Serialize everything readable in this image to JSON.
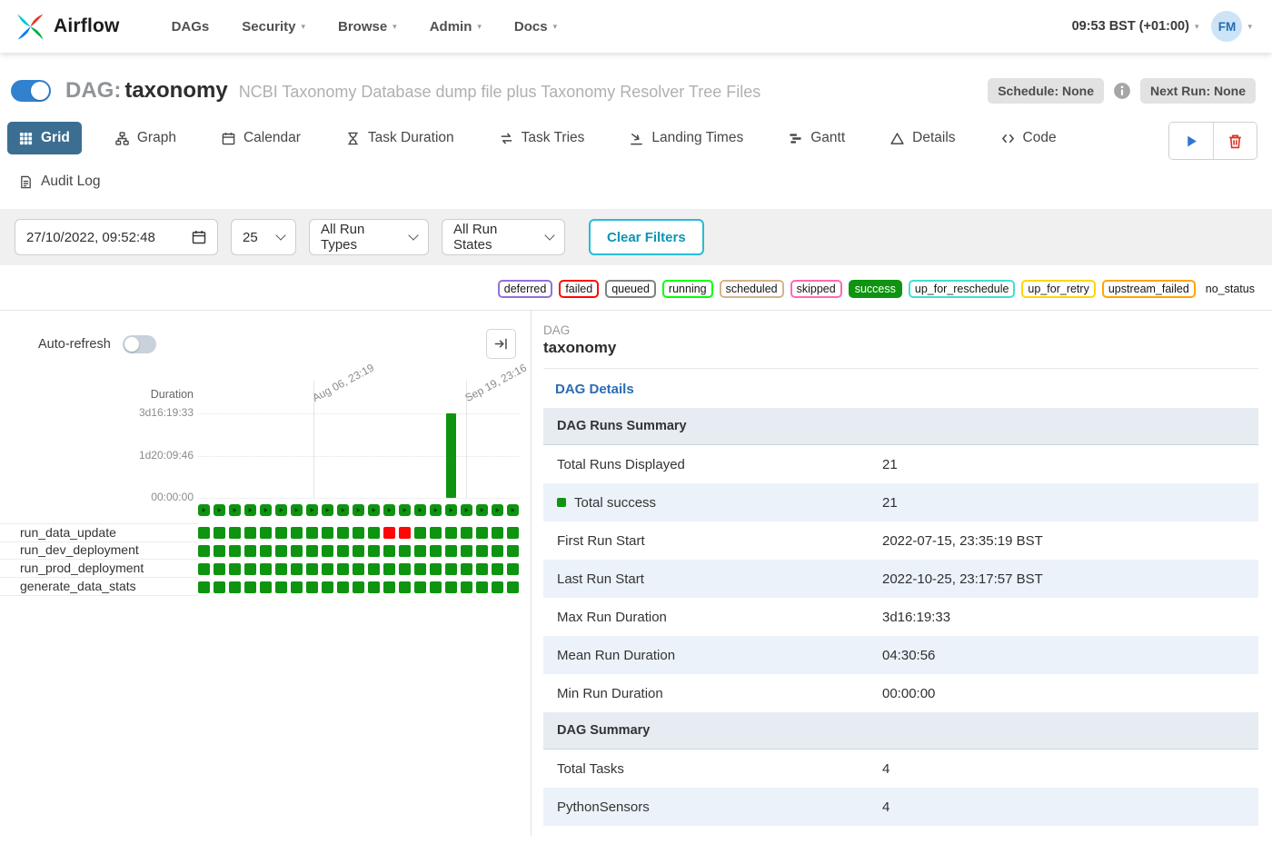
{
  "colors": {
    "active_tab": "#3c6e91",
    "link_blue": "#2b6cb0",
    "toggle_blue": "#3182ce",
    "clear_filters_teal": "#27bcd8",
    "success_green": "#0e9410",
    "failed_red": "#fe0707"
  },
  "navbar": {
    "brand": "Airflow",
    "items": [
      {
        "label": "DAGs",
        "caret": false
      },
      {
        "label": "Security",
        "caret": true
      },
      {
        "label": "Browse",
        "caret": true
      },
      {
        "label": "Admin",
        "caret": true
      },
      {
        "label": "Docs",
        "caret": true
      }
    ],
    "clock": "09:53 BST (+01:00)",
    "avatar_initials": "FM"
  },
  "dag_header": {
    "prefix": "DAG:",
    "name": "taxonomy",
    "description": "NCBI Taxonomy Database dump file plus Taxonomy Resolver Tree Files",
    "enabled": true,
    "schedule_badge": "Schedule: None",
    "next_run_badge": "Next Run: None"
  },
  "tabs": {
    "items": [
      {
        "label": "Grid",
        "icon": "grid-icon",
        "active": true,
        "row": 1
      },
      {
        "label": "Graph",
        "icon": "graph-icon",
        "active": false,
        "row": 1
      },
      {
        "label": "Calendar",
        "icon": "calendar-icon",
        "active": false,
        "row": 1
      },
      {
        "label": "Task Duration",
        "icon": "hourglass-icon",
        "active": false,
        "row": 1
      },
      {
        "label": "Task Tries",
        "icon": "retry-icon",
        "active": false,
        "row": 1
      },
      {
        "label": "Landing Times",
        "icon": "landing-icon",
        "active": false,
        "row": 1
      },
      {
        "label": "Gantt",
        "icon": "gantt-icon",
        "active": false,
        "row": 1
      },
      {
        "label": "Details",
        "icon": "details-icon",
        "active": false,
        "row": 1
      },
      {
        "label": "Code",
        "icon": "code-icon",
        "active": false,
        "row": 1
      },
      {
        "label": "Audit Log",
        "icon": "audit-icon",
        "active": false,
        "row": 2
      }
    ]
  },
  "filters": {
    "datetime": "27/10/2022, 09:52:48",
    "page_size": "25",
    "run_types": "All Run Types",
    "run_states": "All Run States",
    "clear_button": "Clear Filters"
  },
  "legend": {
    "items": [
      {
        "label": "deferred",
        "color": "#9370db",
        "filled": false,
        "plain": false
      },
      {
        "label": "failed",
        "color": "#fe0707",
        "filled": false,
        "plain": false
      },
      {
        "label": "queued",
        "color": "#808080",
        "filled": false,
        "plain": false
      },
      {
        "label": "running",
        "color": "#00ff00",
        "filled": false,
        "plain": false
      },
      {
        "label": "scheduled",
        "color": "#d2b48c",
        "filled": false,
        "plain": false
      },
      {
        "label": "skipped",
        "color": "#ff69b4",
        "filled": false,
        "plain": false
      },
      {
        "label": "success",
        "color": "#0e9410",
        "filled": true,
        "plain": false
      },
      {
        "label": "up_for_reschedule",
        "color": "#40e0d0",
        "filled": false,
        "plain": false
      },
      {
        "label": "up_for_retry",
        "color": "#ffd700",
        "filled": false,
        "plain": false
      },
      {
        "label": "upstream_failed",
        "color": "#ffa500",
        "filled": false,
        "plain": false
      },
      {
        "label": "no_status",
        "color": "#bbbbbb",
        "filled": false,
        "plain": true
      }
    ]
  },
  "grid_panel": {
    "auto_refresh_label": "Auto-refresh",
    "auto_refresh_on": false
  },
  "grid": {
    "run_statuses": [
      "success",
      "success",
      "success",
      "success",
      "success",
      "success",
      "success",
      "success",
      "success",
      "success",
      "success",
      "success",
      "success",
      "success",
      "success",
      "success",
      "success",
      "success",
      "success",
      "success",
      "success"
    ],
    "tasks": [
      {
        "name": "run_data_update",
        "statuses": [
          "success",
          "success",
          "success",
          "success",
          "success",
          "success",
          "success",
          "success",
          "success",
          "success",
          "success",
          "success",
          "failed",
          "failed",
          "success",
          "success",
          "success",
          "success",
          "success",
          "success",
          "success"
        ]
      },
      {
        "name": "run_dev_deployment",
        "statuses": [
          "success",
          "success",
          "success",
          "success",
          "success",
          "success",
          "success",
          "success",
          "success",
          "success",
          "success",
          "success",
          "success",
          "success",
          "success",
          "success",
          "success",
          "success",
          "success",
          "success",
          "success"
        ]
      },
      {
        "name": "run_prod_deployment",
        "statuses": [
          "success",
          "success",
          "success",
          "success",
          "success",
          "success",
          "success",
          "success",
          "success",
          "success",
          "success",
          "success",
          "success",
          "success",
          "success",
          "success",
          "success",
          "success",
          "success",
          "success",
          "success"
        ]
      },
      {
        "name": "generate_data_stats",
        "statuses": [
          "success",
          "success",
          "success",
          "success",
          "success",
          "success",
          "success",
          "success",
          "success",
          "success",
          "success",
          "success",
          "success",
          "success",
          "success",
          "success",
          "success",
          "success",
          "success",
          "success",
          "success"
        ]
      }
    ]
  },
  "chart_data": {
    "type": "bar",
    "title": "DAG run durations",
    "ylabel": "Duration",
    "y_ticks": [
      "3d16:19:33",
      "1d20:09:46",
      "00:00:00"
    ],
    "y_max_seconds": 317973,
    "x_gridlines": [
      {
        "label": "Aug 06, 23:19",
        "position_fraction": 0.36
      },
      {
        "label": "Sep 19, 23:16",
        "position_fraction": 0.836
      }
    ],
    "run_count": 21,
    "values_seconds": [
      0,
      0,
      0,
      0,
      0,
      0,
      0,
      0,
      0,
      0,
      0,
      0,
      0,
      0,
      0,
      0,
      317973,
      0,
      0,
      0,
      0
    ]
  },
  "details_panel": {
    "kicker": "DAG",
    "dag_name": "taxonomy",
    "details_link": "DAG Details",
    "sections": [
      {
        "header": "DAG Runs Summary",
        "rows": [
          {
            "label": "Total Runs Displayed",
            "value": "21"
          },
          {
            "label": "Total success",
            "value": "21",
            "icon": "success-square"
          },
          {
            "label": "First Run Start",
            "value": "2022-07-15, 23:35:19 BST"
          },
          {
            "label": "Last Run Start",
            "value": "2022-10-25, 23:17:57 BST"
          },
          {
            "label": "Max Run Duration",
            "value": "3d16:19:33"
          },
          {
            "label": "Mean Run Duration",
            "value": "04:30:56"
          },
          {
            "label": "Min Run Duration",
            "value": "00:00:00"
          }
        ]
      },
      {
        "header": "DAG Summary",
        "rows": [
          {
            "label": "Total Tasks",
            "value": "4"
          },
          {
            "label": "PythonSensors",
            "value": "4"
          }
        ]
      }
    ]
  }
}
